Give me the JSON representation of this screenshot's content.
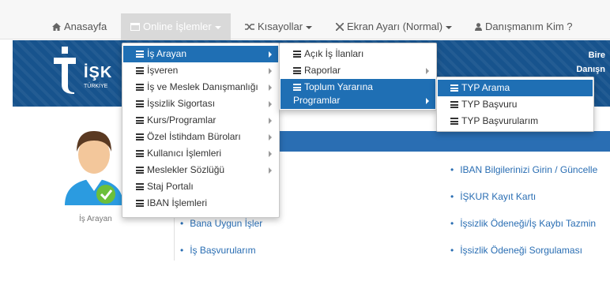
{
  "nav": {
    "home": "Anasayfa",
    "online": "Online İşlemler",
    "shortcuts": "Kısayollar",
    "screen": "Ekran Ayarı (Normal)",
    "advisor": "Danışmanım Kim ?"
  },
  "banner": {
    "logo": "İŞK",
    "logo_sub": "TÜRKİYE",
    "right1": "Bire",
    "right2": "Danışn"
  },
  "menu1": [
    {
      "label": "İş Arayan",
      "arrow": true,
      "selected": true
    },
    {
      "label": "İşveren",
      "arrow": true
    },
    {
      "label": "İş ve Meslek Danışmanlığı",
      "arrow": true
    },
    {
      "label": "İşsizlik Sigortası",
      "arrow": true
    },
    {
      "label": "Kurs/Programlar",
      "arrow": true
    },
    {
      "label": "Özel İstihdam Büroları",
      "arrow": true
    },
    {
      "label": "Kullanıcı İşlemleri",
      "arrow": true
    },
    {
      "label": "Meslekler Sözlüğü",
      "arrow": true
    },
    {
      "label": "Staj Portalı",
      "arrow": false
    },
    {
      "label": "IBAN İşlemleri",
      "arrow": false
    }
  ],
  "menu2": [
    {
      "label": "Açık İş İlanları"
    },
    {
      "label": "Raporlar"
    },
    {
      "label1": "Toplum Yararına",
      "label2": "Programlar"
    }
  ],
  "menu3": [
    {
      "label": "TYP Arama"
    },
    {
      "label": "TYP Başvuru"
    },
    {
      "label": "TYP Başvurularım"
    }
  ],
  "avatar_label": "İş Arayan",
  "links_left": [
    "Bana Uygun İşler",
    "İş Başvurularım"
  ],
  "links_right": [
    "IBAN Bilgilerinizi Girin / Güncelle",
    "İŞKUR Kayıt Kartı",
    "İşsizlik Ödeneği/İş Kaybı Tazmin",
    "İşsizlik Ödeneği Sorgulaması"
  ],
  "colors": {
    "brand": "#17538d",
    "accent": "#1f6fb4"
  }
}
